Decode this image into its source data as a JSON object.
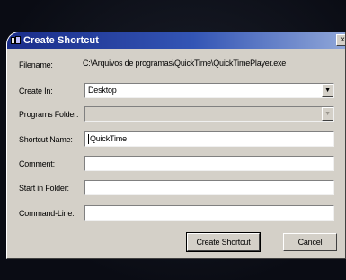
{
  "window": {
    "title": "Create Shortcut",
    "close_glyph": "×"
  },
  "form": {
    "filename": {
      "label": "Filename:",
      "value": "C:\\Arquivos de programas\\QuickTime\\QuickTimePlayer.exe"
    },
    "create_in": {
      "label": "Create In:",
      "value": "Desktop"
    },
    "programs_folder": {
      "label": "Programs Folder:",
      "value": ""
    },
    "shortcut_name": {
      "label": "Shortcut Name:",
      "value": "QuickTime"
    },
    "comment": {
      "label": "Comment:",
      "value": ""
    },
    "start_in_folder": {
      "label": "Start in Folder:",
      "value": ""
    },
    "command_line": {
      "label": "Command-Line:",
      "value": ""
    }
  },
  "buttons": {
    "create_shortcut": "Create Shortcut",
    "cancel": "Cancel"
  },
  "icons": {
    "dropdown_arrow": "▼"
  }
}
